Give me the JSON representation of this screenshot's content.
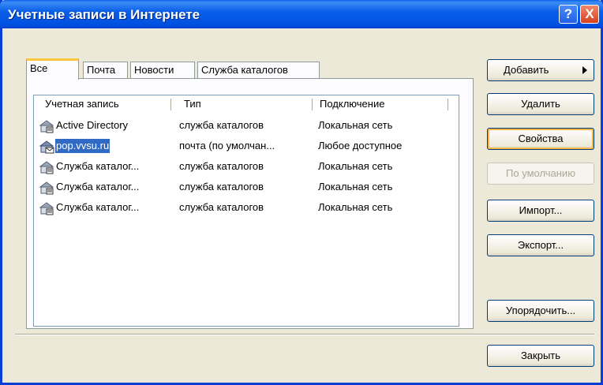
{
  "window": {
    "title": "Учетные записи в Интернете"
  },
  "titlebar_buttons": {
    "help": "?",
    "close": "X"
  },
  "tabs": [
    {
      "label": "Все"
    },
    {
      "label": "Почта"
    },
    {
      "label": "Новости"
    },
    {
      "label": "Служба каталогов"
    }
  ],
  "list": {
    "columns": [
      "Учетная запись",
      "Тип",
      "Подключение"
    ],
    "rows": [
      {
        "name": "Active Directory",
        "type": "служба каталогов",
        "conn": "Локальная сеть",
        "icon": "directory-service-icon"
      },
      {
        "name": "pop.vvsu.ru",
        "type": "почта (по умолчан...",
        "conn": "Любое доступное",
        "icon": "mail-account-icon",
        "selected": true
      },
      {
        "name": "Служба каталог...",
        "type": "служба каталогов",
        "conn": "Локальная сеть",
        "icon": "directory-service-icon"
      },
      {
        "name": "Служба каталог...",
        "type": "служба каталогов",
        "conn": "Локальная сеть",
        "icon": "directory-service-icon"
      },
      {
        "name": "Служба каталог...",
        "type": "служба каталогов",
        "conn": "Локальная сеть",
        "icon": "directory-service-icon"
      }
    ]
  },
  "buttons": {
    "add": "Добавить",
    "delete": "Удалить",
    "properties": "Свойства",
    "default": "По умолчанию",
    "import": "Импорт...",
    "export": "Экспорт...",
    "order": "Упорядочить...",
    "close": "Закрыть"
  },
  "colors": {
    "title_blue": "#0a5fe8",
    "selection": "#316ac5",
    "tab_highlight": "#ffc83c",
    "dialog_bg": "#ece9d8"
  }
}
